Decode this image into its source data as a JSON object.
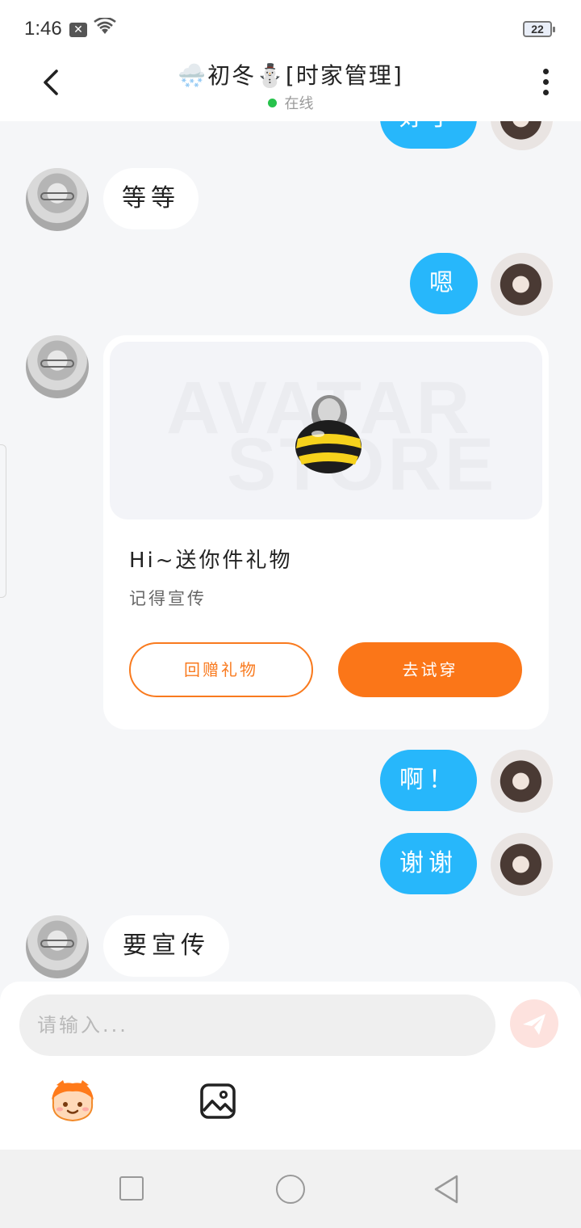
{
  "status_bar": {
    "time": "1:46",
    "notification_glyph": "✕",
    "battery_level": "22"
  },
  "header": {
    "title": "🌨️初冬⛄[时家管理]",
    "status": "在线"
  },
  "messages": [
    {
      "side": "right",
      "text": "好了"
    },
    {
      "side": "left",
      "text": "等等"
    },
    {
      "side": "right",
      "text": "嗯"
    },
    {
      "side": "left",
      "type": "gift"
    },
    {
      "side": "right",
      "text": "啊！"
    },
    {
      "side": "right",
      "text": "谢谢"
    },
    {
      "side": "left",
      "text": "要宣传"
    }
  ],
  "gift_card": {
    "watermark_line1": "AVATAR",
    "watermark_line2": "STORE",
    "title": "Hi~送你件礼物",
    "subtitle": "记得宣传",
    "return_gift_label": "回赠礼物",
    "try_on_label": "去试穿"
  },
  "input": {
    "placeholder": "请输入..."
  },
  "colors": {
    "accent_blue": "#27b7fb",
    "accent_orange": "#fb7618",
    "online_green": "#27c24c"
  },
  "icons": {
    "back": "chevron-left-icon",
    "more": "more-vertical-icon",
    "send": "send-icon",
    "emoji": "emoji-face-icon",
    "image": "image-icon"
  }
}
